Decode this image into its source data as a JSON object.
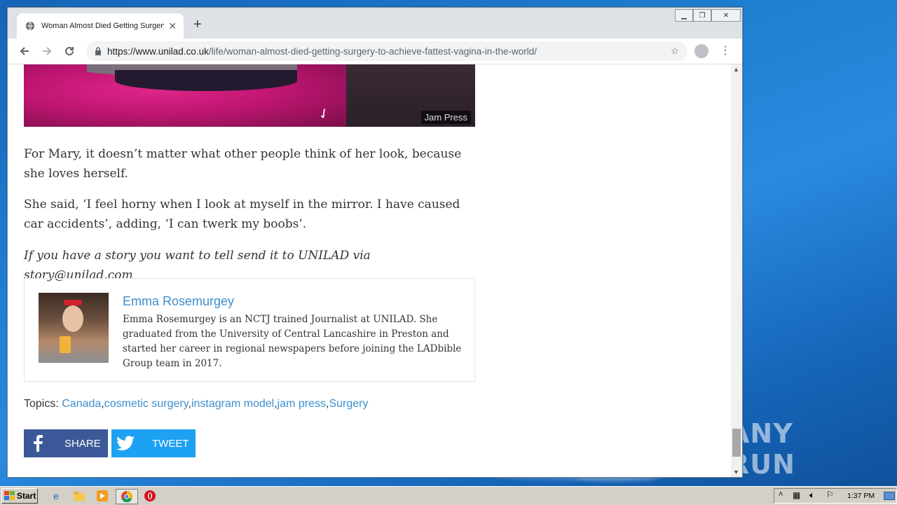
{
  "browser": {
    "tab_title": "Woman Almost Died Getting Surgery To",
    "url_host": "https://www.unilad.co.uk",
    "url_path": "/life/woman-almost-died-getting-surgery-to-achieve-fattest-vagina-in-the-world/"
  },
  "image": {
    "credit": "Jam Press"
  },
  "article": {
    "para1": "For Mary, it doesn’t matter what other people think of her look, because she loves herself.",
    "para2": "She said, ‘I feel horny when I look at myself in the mirror. I have caused car accidents’, adding, ‘I can twerk my boobs’.",
    "para3": "If you have a story you want to tell send it to UNILAD via story@unilad.com"
  },
  "author": {
    "name": "Emma Rosemurgey",
    "bio": "Emma Rosemurgey is an NCTJ trained Journalist at UNILAD. She graduated from the University of Central Lancashire in Preston and started her career in regional newspapers before joining the LADbible Group team in 2017."
  },
  "topics": {
    "label": "Topics:",
    "items": [
      "Canada",
      "cosmetic surgery",
      "instagram model",
      "jam press",
      "Surgery"
    ]
  },
  "share": {
    "facebook_label": "SHARE",
    "twitter_label": "TWEET"
  },
  "taskbar": {
    "start_label": "Start",
    "clock": "1:37 PM"
  },
  "watermark": "ANY RUN",
  "colors": {
    "link": "#3b8fd0",
    "facebook": "#3b5998",
    "twitter": "#1da1f2",
    "desktop": "#1f7fd1"
  }
}
